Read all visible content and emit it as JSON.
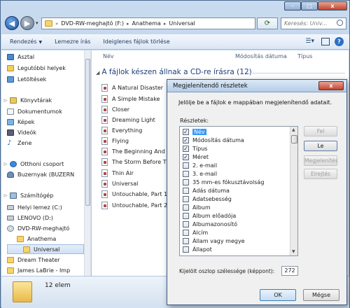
{
  "window": {
    "minimize_icon": "minimize-icon",
    "maximize_icon": "maximize-icon",
    "close_label": "x"
  },
  "address": {
    "crumbs": [
      "DVD-RW-meghajtó (F:)",
      "Anathema",
      "Universal"
    ],
    "refresh_icon": "refresh-icon",
    "search_placeholder": "Keresés: Univ..."
  },
  "toolbar": {
    "organize": "Rendezés",
    "burn": "Lemezre írás",
    "delete_temp": "Ideiglenes fájlok törlése"
  },
  "sidebar": {
    "items": [
      {
        "label": "Asztal",
        "icon": "desktop-icon"
      },
      {
        "label": "Legutóbbi helyek",
        "icon": "recent-places-icon"
      },
      {
        "label": "Letöltések",
        "icon": "downloads-icon"
      },
      {
        "label": "Könyvtárak",
        "icon": "libraries-icon"
      },
      {
        "label": "Dokumentumok",
        "icon": "documents-icon"
      },
      {
        "label": "Képek",
        "icon": "pictures-icon"
      },
      {
        "label": "Videók",
        "icon": "videos-icon"
      },
      {
        "label": "Zene",
        "icon": "music-icon"
      },
      {
        "label": "Otthoni csoport",
        "icon": "homegroup-icon"
      },
      {
        "label": "Buzernyak (BUZERN",
        "icon": "user-icon"
      },
      {
        "label": "Számítógép",
        "icon": "computer-icon"
      },
      {
        "label": "Helyi lemez (C:)",
        "icon": "drive-icon"
      },
      {
        "label": "LENOVO (D:)",
        "icon": "drive-icon"
      },
      {
        "label": "DVD-RW-meghajtó",
        "icon": "dvd-icon"
      },
      {
        "label": "Anathema",
        "icon": "folder-icon"
      },
      {
        "label": "Universal",
        "icon": "folder-icon"
      },
      {
        "label": "Dream Theater",
        "icon": "folder-icon"
      },
      {
        "label": "James LaBrie - Imp",
        "icon": "folder-icon"
      }
    ]
  },
  "filelist": {
    "col_name": "Név",
    "col_modified": "Módosítás dátuma",
    "col_type": "Típus",
    "group_header": "A fájlok készen állnak a CD-re írásra (12)",
    "files": [
      "A Natural Disaster",
      "A Simple Mistake",
      "Closer",
      "Dreaming Light",
      "Everything",
      "Flying",
      "The Beginning And The",
      "The Storm Before The",
      "Thin Air",
      "Universal",
      "Untouchable, Part 1",
      "Untouchable, Part 2"
    ]
  },
  "status": {
    "count": "12 elem"
  },
  "dialog": {
    "title": "Megjelenítendő részletek",
    "close_label": "x",
    "description": "Jelölje be a fájlok e mappában megjelenítendő adatait.",
    "details_label": "Részletek:",
    "details": [
      {
        "label": "Név",
        "checked": true,
        "selected": true
      },
      {
        "label": "Módosítás dátuma",
        "checked": true
      },
      {
        "label": "Típus",
        "checked": true
      },
      {
        "label": "Méret",
        "checked": true
      },
      {
        "label": "2. e-mail",
        "checked": false
      },
      {
        "label": "3. e-mail",
        "checked": false
      },
      {
        "label": "35 mm-es fókusztávolság",
        "checked": false
      },
      {
        "label": "Adás dátuma",
        "checked": false
      },
      {
        "label": "Adatsebesség",
        "checked": false
      },
      {
        "label": "Album",
        "checked": false
      },
      {
        "label": "Album előadója",
        "checked": false
      },
      {
        "label": "Albumazonosító",
        "checked": false
      },
      {
        "label": "Alcím",
        "checked": false
      },
      {
        "label": "Állam vagy megye",
        "checked": false
      },
      {
        "label": "Állapot",
        "checked": false
      }
    ],
    "btn_up": "Fel",
    "btn_down": "Le",
    "btn_show": "Megjelenítés",
    "btn_hide": "Elrejtés",
    "width_label": "Kijelölt oszlop szélessége (képpont):",
    "width_value": "272",
    "ok": "OK",
    "cancel": "Mégse"
  },
  "colors": {
    "selection": "#3399ff",
    "group_header": "#1e3e7a",
    "close_red": "#c3432c"
  }
}
